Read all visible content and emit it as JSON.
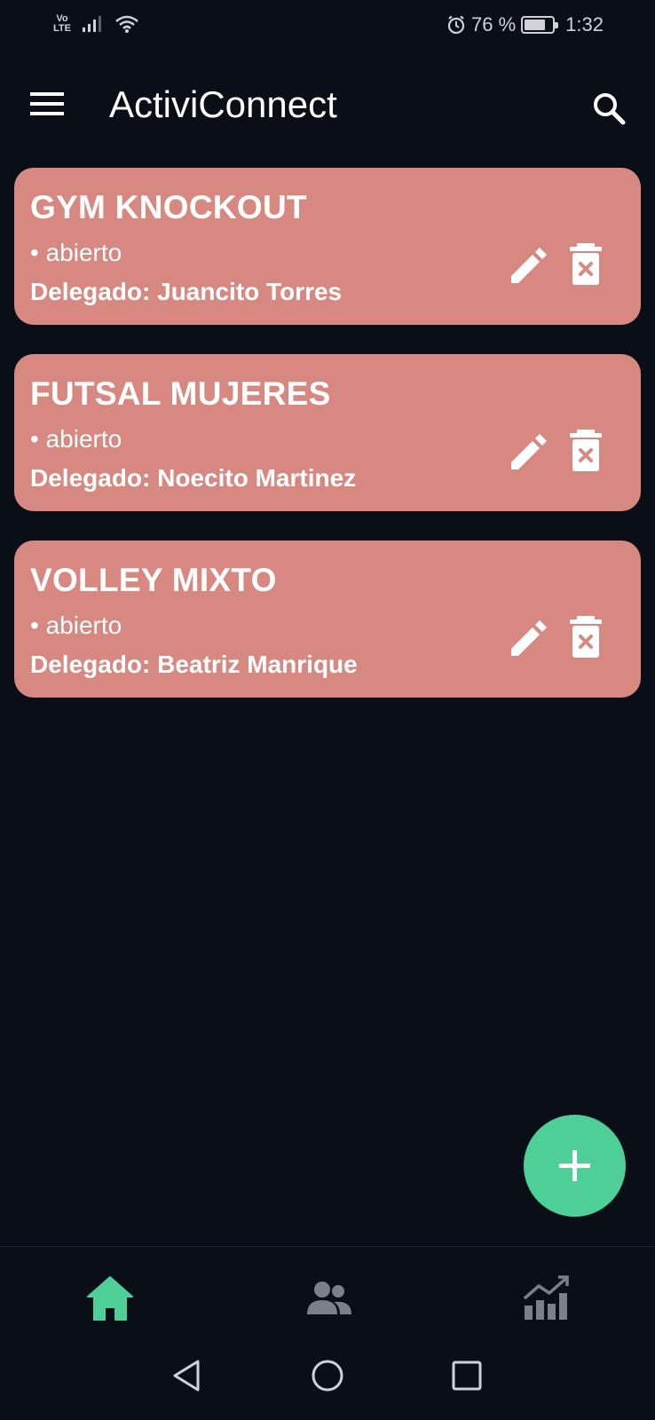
{
  "status_bar": {
    "network_top": "Vo",
    "network_bottom": "LTE",
    "battery_text": "76 %",
    "battery_level": 0.76,
    "time": "1:32"
  },
  "app_bar": {
    "title": "ActiviConnect",
    "menu_icon": "hamburger-menu-icon",
    "search_icon": "search-icon"
  },
  "activities": [
    {
      "title": "GYM KNOCKOUT",
      "status": "• abierto",
      "delegate": "Delegado: Juancito Torres"
    },
    {
      "title": "FUTSAL MUJERES",
      "status": "• abierto",
      "delegate": "Delegado: Noecito Martinez"
    },
    {
      "title": "VOLLEY MIXTO",
      "status": "• abierto",
      "delegate": "Delegado: Beatriz Manrique"
    }
  ],
  "card_icons": {
    "edit": "pencil-icon",
    "delete": "trash-icon"
  },
  "fab": {
    "icon": "plus-icon"
  },
  "bottom_nav": [
    {
      "icon": "home-icon",
      "active": true
    },
    {
      "icon": "people-icon",
      "active": false
    },
    {
      "icon": "chart-icon",
      "active": false
    }
  ],
  "system_nav": [
    "back-icon",
    "home-circle-icon",
    "recents-icon"
  ],
  "colors": {
    "background": "#0a0e17",
    "card": "#d78981",
    "accent": "#4ecf97",
    "inactive_icon": "#7b8088",
    "text": "#ffffff"
  }
}
